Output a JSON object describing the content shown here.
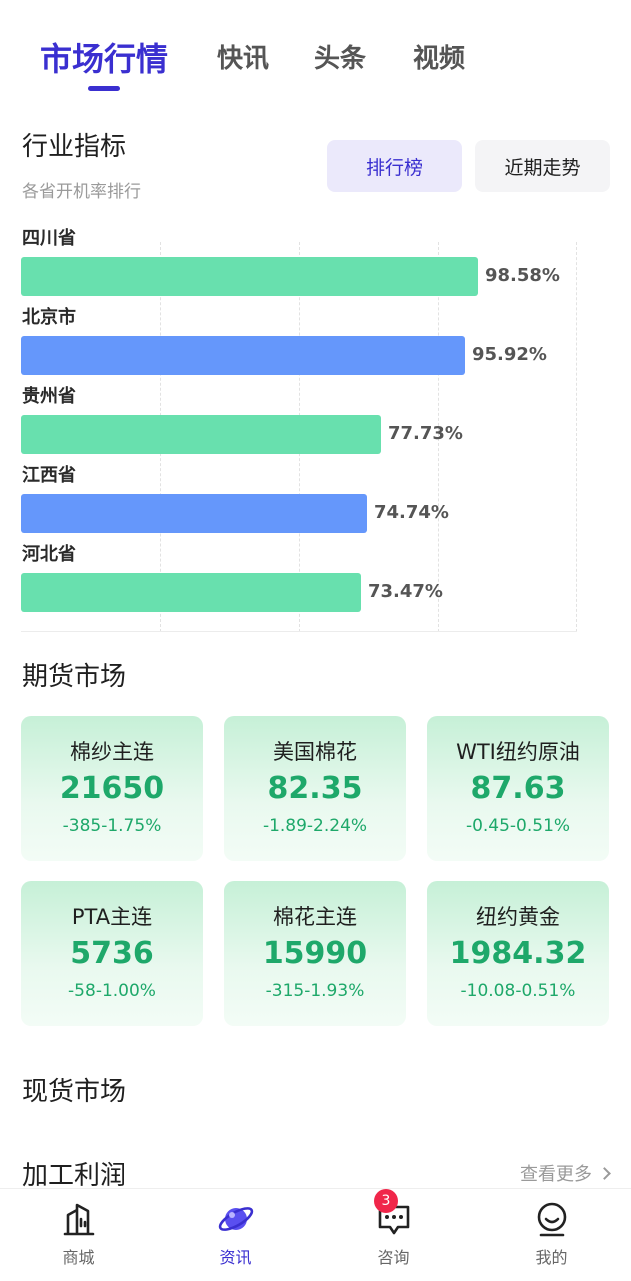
{
  "tabs": [
    {
      "label": "市场行情",
      "active": true
    },
    {
      "label": "快讯",
      "active": false
    },
    {
      "label": "头条",
      "active": false
    },
    {
      "label": "视频",
      "active": false
    }
  ],
  "industry": {
    "title": "行业指标",
    "subtitle": "各省开机率排行",
    "toggle": {
      "rank_label": "排行榜",
      "trend_label": "近期走势",
      "selected": "排行榜"
    }
  },
  "chart_data": {
    "type": "bar",
    "orientation": "horizontal",
    "categories": [
      "四川省",
      "北京市",
      "贵州省",
      "江西省",
      "河北省"
    ],
    "values": [
      98.58,
      95.92,
      77.73,
      74.74,
      73.47
    ],
    "value_labels": [
      "98.58%",
      "95.92%",
      "77.73%",
      "74.74%",
      "73.47%"
    ],
    "bar_colors": [
      "#68e0ae",
      "#6597fb",
      "#68e0ae",
      "#6597fb",
      "#68e0ae"
    ],
    "grid": true,
    "xlim": [
      0,
      120
    ]
  },
  "futures": {
    "title": "期货市场",
    "items": [
      {
        "name": "棉纱主连",
        "price": "21650",
        "change": "-385-1.75%"
      },
      {
        "name": "美国棉花",
        "price": "82.35",
        "change": "-1.89-2.24%"
      },
      {
        "name": "WTI纽约原油",
        "price": "87.63",
        "change": "-0.45-0.51%"
      },
      {
        "name": "PTA主连",
        "price": "5736",
        "change": "-58-1.00%"
      },
      {
        "name": "棉花主连",
        "price": "15990",
        "change": "-315-1.93%"
      },
      {
        "name": "纽约黄金",
        "price": "1984.32",
        "change": "-10.08-0.51%"
      }
    ]
  },
  "spot": {
    "title": "现货市场"
  },
  "processing": {
    "title": "加工利润",
    "more_label": "查看更多"
  },
  "bottom_nav": {
    "items": [
      {
        "label": "商城",
        "icon": "building-chart-icon"
      },
      {
        "label": "资讯",
        "icon": "planet-icon",
        "active": true
      },
      {
        "label": "咨询",
        "icon": "chat-bubble-icon",
        "badge": "3"
      },
      {
        "label": "我的",
        "icon": "smiley-face-icon"
      }
    ]
  },
  "colors": {
    "accent": "#3a2fd0",
    "green": "#1ea86a",
    "bar_green": "#68e0ae",
    "bar_blue": "#6597fb",
    "badge": "#f0264a"
  }
}
